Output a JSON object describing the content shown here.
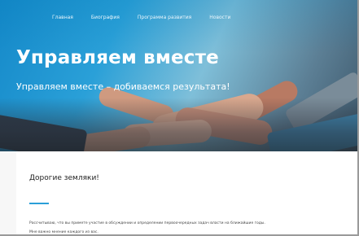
{
  "nav": {
    "items": [
      {
        "label": "Главная"
      },
      {
        "label": "Биография"
      },
      {
        "label": "Программа развития"
      },
      {
        "label": "Новости"
      }
    ]
  },
  "hero": {
    "title": "Управляем вместе",
    "subtitle": "Управляем вместе – добиваемся результата!"
  },
  "content": {
    "heading": "Дорогие земляки!",
    "paragraph": "Рассчитываю, что вы примете участие в обсуждении и определении первоочередных задач власти на ближайшие годы. Мне важно мнение каждого из вас."
  },
  "colors": {
    "accent": "#2a9fd8",
    "hero_blue": "#1589c9"
  }
}
